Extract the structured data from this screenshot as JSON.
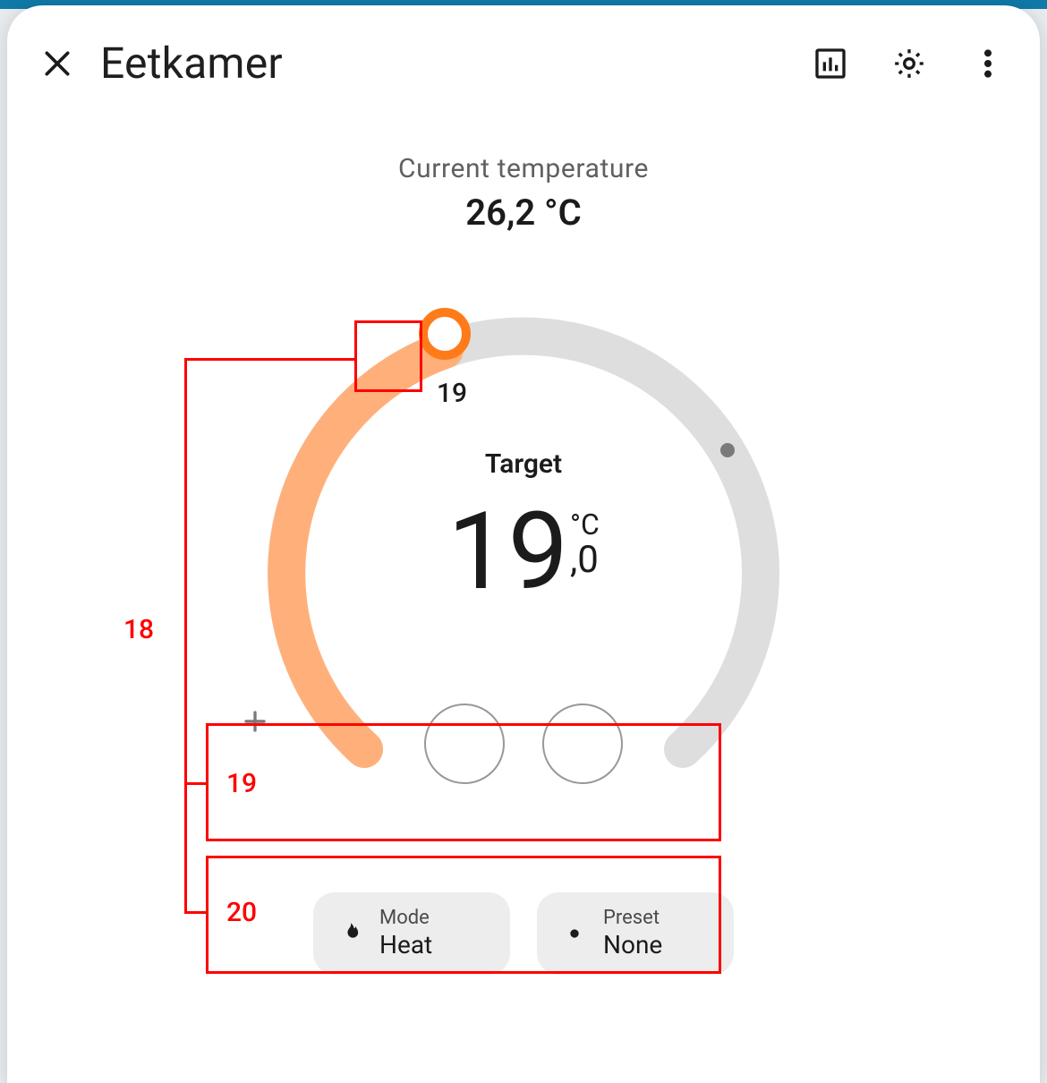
{
  "header": {
    "title": "Eetkamer"
  },
  "current": {
    "label": "Current temperature",
    "value": "26,2 °C"
  },
  "target": {
    "label": "Target",
    "int": "19",
    "fraction": ",0",
    "unit": "°C"
  },
  "dial": {
    "tick_label": "19"
  },
  "mode_chip": {
    "label": "Mode",
    "value": "Heat"
  },
  "preset_chip": {
    "label": "Preset",
    "value": "None"
  },
  "annotations": {
    "a18": "18",
    "a19_small": "19",
    "a19": "19",
    "a20": "20"
  }
}
